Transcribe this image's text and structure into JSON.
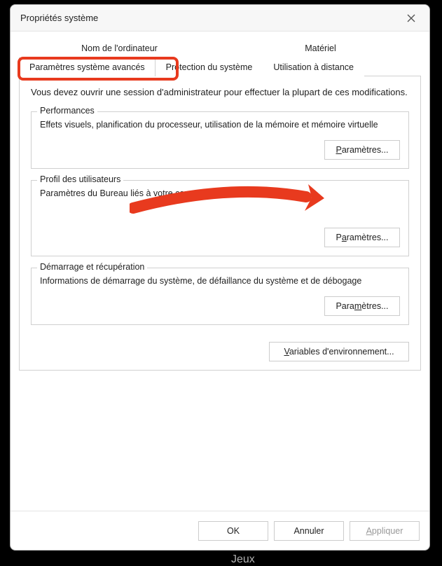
{
  "window": {
    "title": "Propriétés système"
  },
  "tabs": {
    "row1": [
      {
        "label": "Nom de l'ordinateur"
      },
      {
        "label": "Matériel"
      }
    ],
    "row2": [
      {
        "label": "Paramètres système avancés",
        "active": true
      },
      {
        "label": "Protection du système"
      },
      {
        "label": "Utilisation à distance"
      }
    ]
  },
  "adminNote": "Vous devez ouvrir une session d'administrateur pour effectuer la plupart de ces modifications.",
  "groups": {
    "perf": {
      "legend": "Performances",
      "desc": "Effets visuels, planification du processeur, utilisation de la mémoire et mémoire virtuelle",
      "button": "Paramètres..."
    },
    "profile": {
      "legend": "Profil des utilisateurs",
      "desc": "Paramètres du Bureau liés à votre connexion",
      "button": "Paramètres..."
    },
    "recovery": {
      "legend": "Démarrage et récupération",
      "desc": "Informations de démarrage du système, de défaillance du système et de débogage",
      "button": "Paramètres..."
    }
  },
  "envButton": "Variables d'environnement...",
  "footer": {
    "ok": "OK",
    "cancel": "Annuler",
    "apply": "Appliquer"
  },
  "background": {
    "jeux": "Jeux"
  },
  "annotations": {
    "highlightTab": "Paramètres système avancés",
    "arrowTarget": "Paramètres (Performances)"
  }
}
